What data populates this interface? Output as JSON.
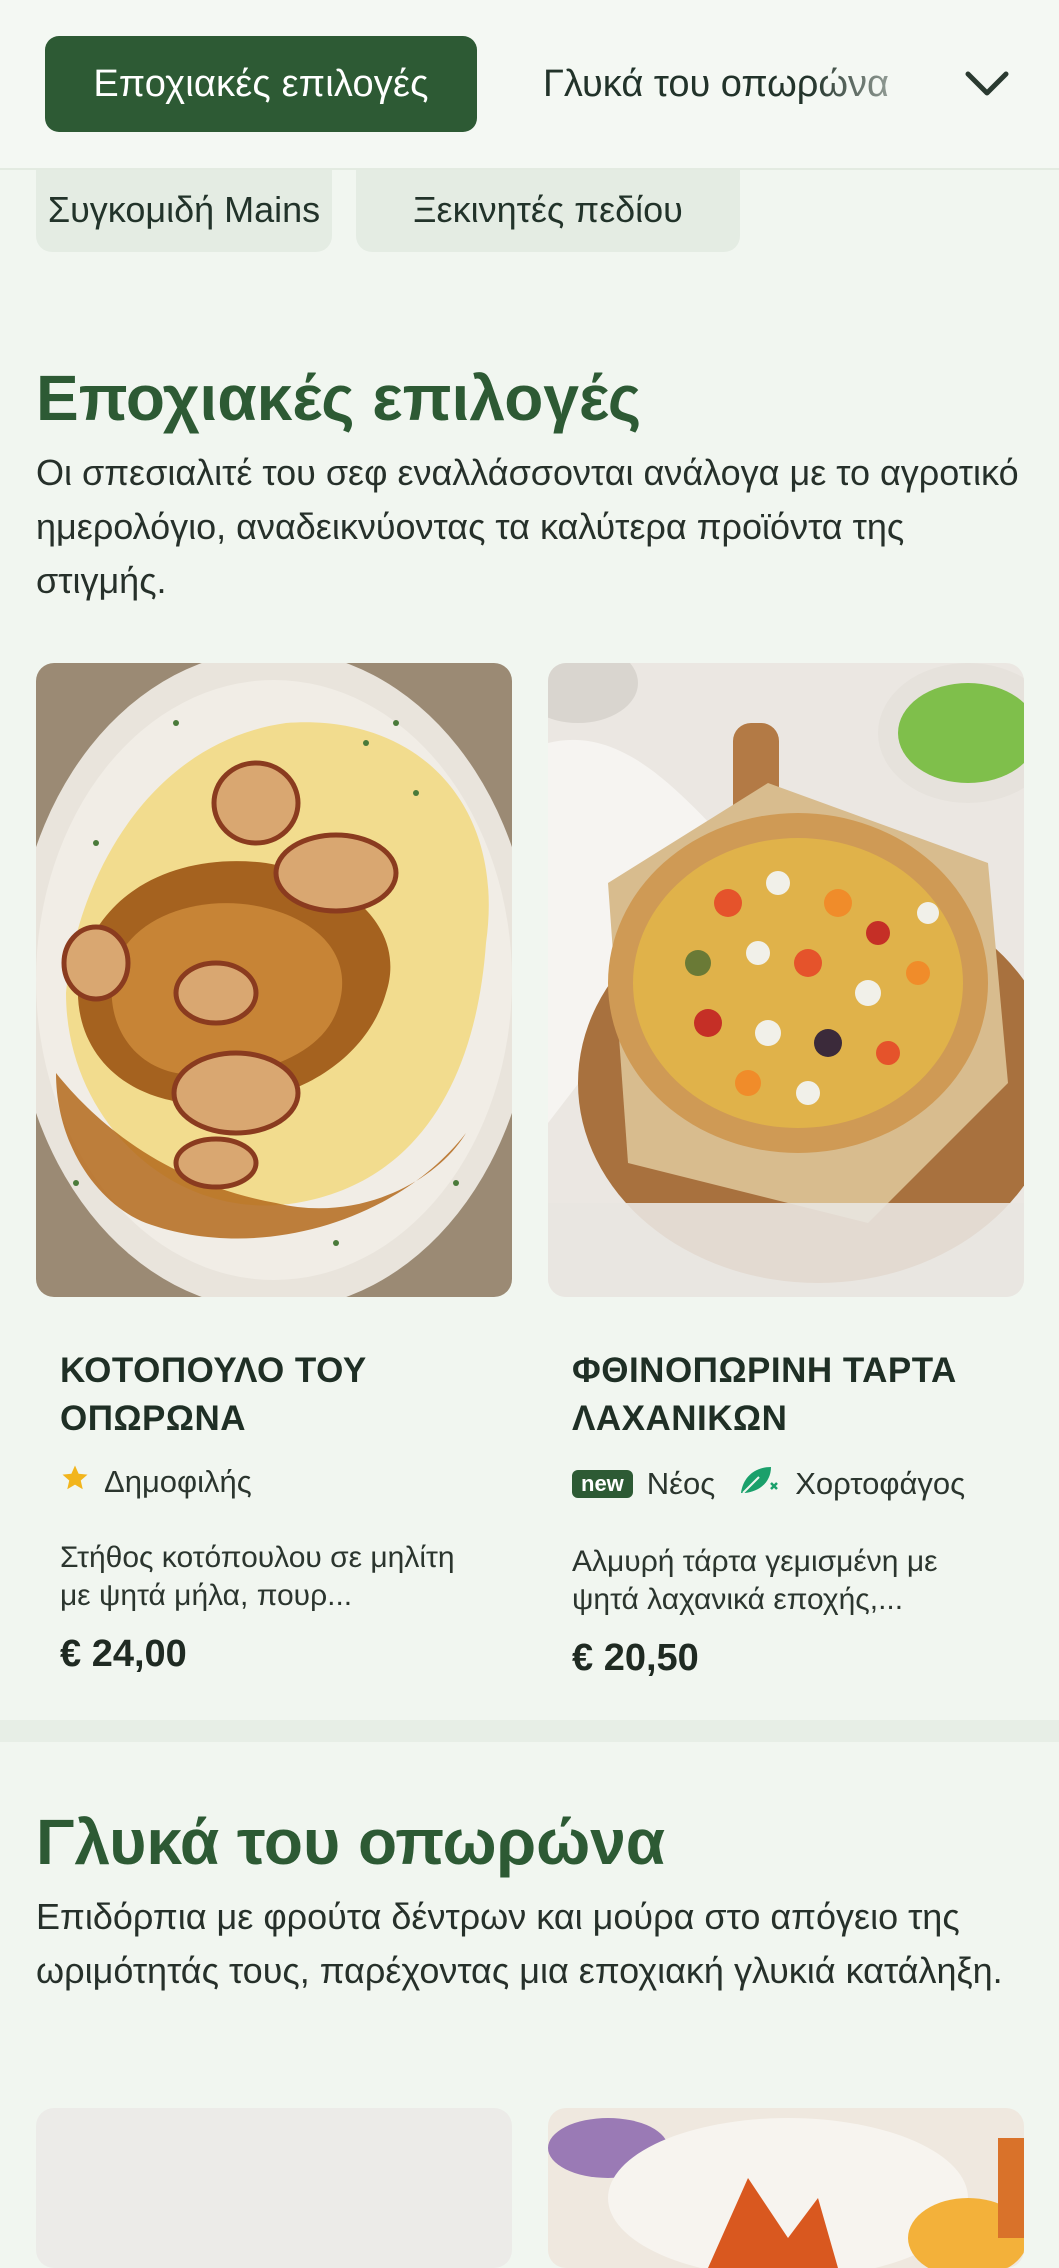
{
  "nav": {
    "active_tab": "Εποχιακές επιλογές",
    "next_tab": "Γλυκά του οπωρώνα",
    "row2": [
      "Συγκομιδή Mains",
      "Ξεκινητές πεδίου"
    ]
  },
  "section1": {
    "title": "Εποχιακές επιλογές",
    "description": "Οι σπεσιαλιτέ του σεφ εναλλάσσονται ανάλογα με το αγροτικό ημερολόγιο, αναδεικνύοντας τα καλύτερα προϊόντα της στιγμής."
  },
  "cards": [
    {
      "title": "ΚΟΤΟΠΟΥΛΟ ΤΟΥ ΟΠΩΡΩΝΑ",
      "badge": "Δημοφιλής",
      "description": "Στήθος κοτόπουλου σε μηλίτη με ψητά μήλα, πουρ...",
      "price": "€ 24,00"
    },
    {
      "title": "ΦΘΙΝΟΠΩΡΙΝΗ ΤΑΡΤΑ ΛΑΧΑΝΙΚΩΝ",
      "badge_new": "new",
      "badge_new_label": "Νέος",
      "badge_veg": "Χορτοφάγος",
      "description": "Αλμυρή τάρτα γεμισμένη με ψητά λαχανικά εποχής,...",
      "price": "€ 20,50"
    }
  ],
  "section2": {
    "title": "Γλυκά του οπωρώνα",
    "description": "Επιδόρπια με φρούτα δέντρων και μούρα στο απόγειο της ωριμότητάς τους, παρέχοντας μια εποχιακή γλυκιά κατάληξη."
  },
  "colors": {
    "brand": "#2d5a34",
    "background": "#f1f6f0",
    "star": "#f2b51c",
    "veg": "#1aa06b"
  },
  "icons": [
    "chevron-down-icon",
    "star-icon",
    "leaf-icon"
  ]
}
